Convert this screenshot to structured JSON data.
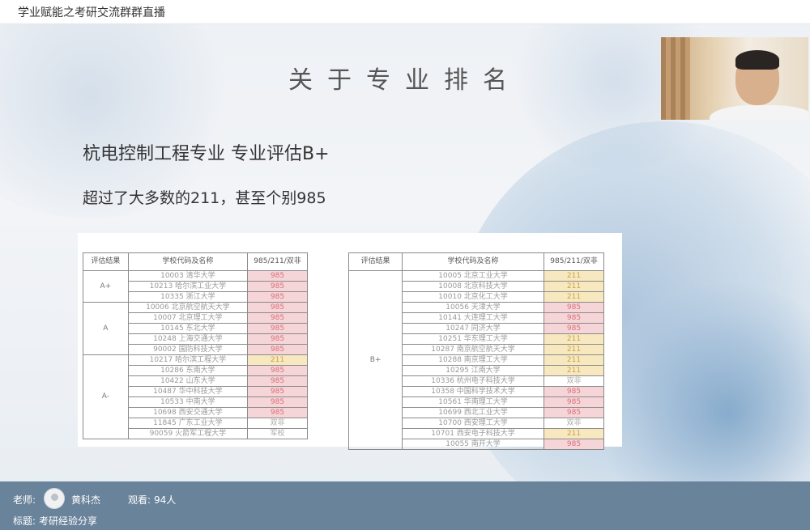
{
  "window": {
    "title": "学业赋能之考研交流群群直播"
  },
  "slide": {
    "title": "关于专业排名",
    "line1": "杭电控制工程专业 专业评估B+",
    "line2": "超过了大多数的211，甚至个别985"
  },
  "table_headers": {
    "grade": "评估结果",
    "school": "学校代码及名称",
    "tag": "985/211/双非"
  },
  "left_table": {
    "groups": [
      {
        "grade": "A+",
        "rows": [
          {
            "school": "10003 清华大学",
            "tag": "985",
            "type": "985"
          },
          {
            "school": "10213 哈尔滨工业大学",
            "tag": "985",
            "type": "985"
          },
          {
            "school": "10335 浙江大学",
            "tag": "985",
            "type": "985"
          }
        ]
      },
      {
        "grade": "A",
        "rows": [
          {
            "school": "10006 北京航空航天大学",
            "tag": "985",
            "type": "985"
          },
          {
            "school": "10007 北京理工大学",
            "tag": "985",
            "type": "985"
          },
          {
            "school": "10145 东北大学",
            "tag": "985",
            "type": "985"
          },
          {
            "school": "10248 上海交通大学",
            "tag": "985",
            "type": "985"
          },
          {
            "school": "90002 国防科技大学",
            "tag": "985",
            "type": "985"
          }
        ]
      },
      {
        "grade": "A-",
        "rows": [
          {
            "school": "10217 哈尔滨工程大学",
            "tag": "211",
            "type": "211"
          },
          {
            "school": "10286 东南大学",
            "tag": "985",
            "type": "985"
          },
          {
            "school": "10422 山东大学",
            "tag": "985",
            "type": "985"
          },
          {
            "school": "10487 华中科技大学",
            "tag": "985",
            "type": "985"
          },
          {
            "school": "10533 中南大学",
            "tag": "985",
            "type": "985"
          },
          {
            "school": "10698 西安交通大学",
            "tag": "985",
            "type": "985"
          },
          {
            "school": "11845 广东工业大学",
            "tag": "双非",
            "type": "non"
          },
          {
            "school": "90059 火箭军工程大学",
            "tag": "军校",
            "type": "non"
          }
        ]
      }
    ]
  },
  "right_table": {
    "groups": [
      {
        "grade": "B+",
        "rows": [
          {
            "school": "10005 北京工业大学",
            "tag": "211",
            "type": "211"
          },
          {
            "school": "10008 北京科技大学",
            "tag": "211",
            "type": "211"
          },
          {
            "school": "10010 北京化工大学",
            "tag": "211",
            "type": "211"
          },
          {
            "school": "10056 天津大学",
            "tag": "985",
            "type": "985"
          },
          {
            "school": "10141 大连理工大学",
            "tag": "985",
            "type": "985"
          },
          {
            "school": "10247 同济大学",
            "tag": "985",
            "type": "985"
          },
          {
            "school": "10251 华东理工大学",
            "tag": "211",
            "type": "211"
          },
          {
            "school": "10287 南京航空航天大学",
            "tag": "211",
            "type": "211"
          },
          {
            "school": "10288 南京理工大学",
            "tag": "211",
            "type": "211"
          },
          {
            "school": "10295 江南大学",
            "tag": "211",
            "type": "211"
          },
          {
            "school": "10336 杭州电子科技大学",
            "tag": "双非",
            "type": "non"
          },
          {
            "school": "10358 中国科学技术大学",
            "tag": "985",
            "type": "985"
          },
          {
            "school": "10561 华南理工大学",
            "tag": "985",
            "type": "985"
          },
          {
            "school": "10699 西北工业大学",
            "tag": "985",
            "type": "985"
          },
          {
            "school": "10700 西安理工大学",
            "tag": "双非",
            "type": "non"
          },
          {
            "school": "10701 西安电子科技大学",
            "tag": "211",
            "type": "211"
          },
          {
            "school": "10055 南开大学",
            "tag": "985",
            "type": "985"
          }
        ]
      }
    ]
  },
  "bottom": {
    "teacher_label": "老师:",
    "teacher_name": "黄科杰",
    "viewers_label": "观看:",
    "viewers_count": "94人",
    "topic_label": "标题:",
    "topic": "考研经验分享"
  }
}
